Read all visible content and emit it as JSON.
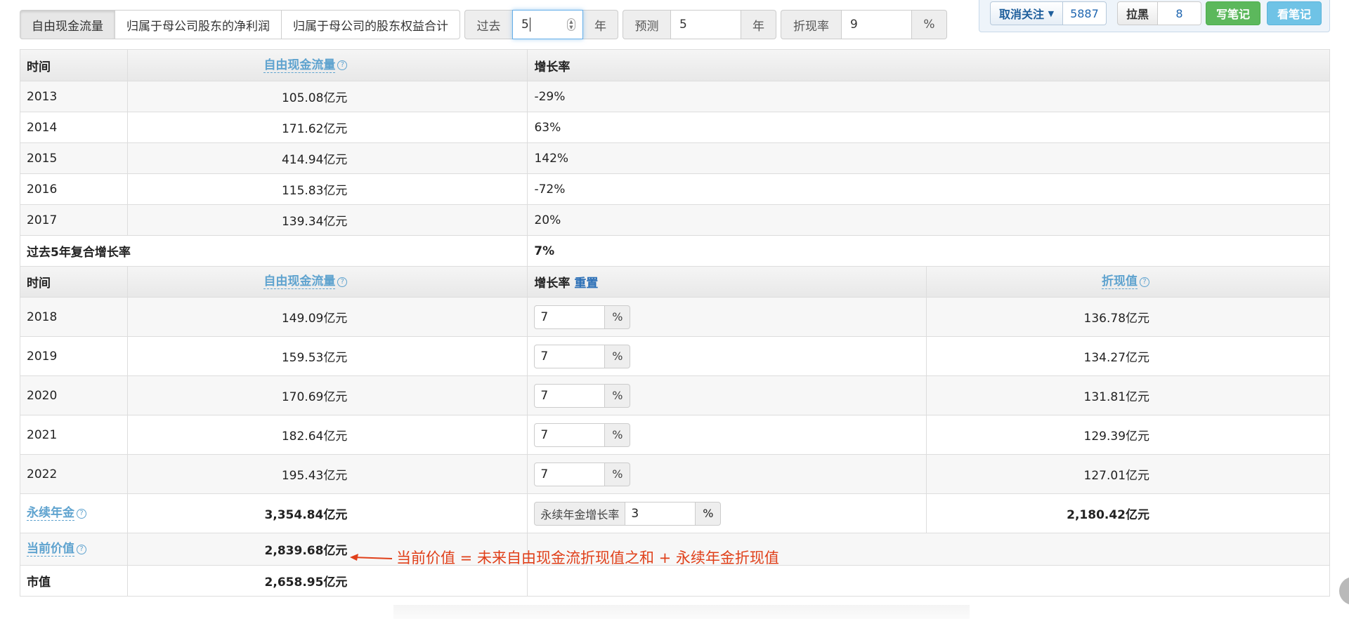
{
  "tabs": [
    "自由现金流量",
    "归属于母公司股东的净利润",
    "归属于母公司的股东权益合计"
  ],
  "params": {
    "past_label": "过去",
    "past_value": "5",
    "past_unit": "年",
    "forecast_label": "预测",
    "forecast_value": "5",
    "forecast_unit": "年",
    "discount_label": "折现率",
    "discount_value": "9",
    "discount_unit": "%"
  },
  "panel": {
    "follow_label": "取消关注",
    "follow_count": "5887",
    "block_label": "拉黑",
    "block_count": "8",
    "write_note": "写笔记",
    "view_note": "看笔记"
  },
  "history": {
    "headers": {
      "time": "时间",
      "fcf": "自由现金流量",
      "growth": "增长率"
    },
    "rows": [
      {
        "year": "2013",
        "fcf": "105.08亿元",
        "growth": "-29%"
      },
      {
        "year": "2014",
        "fcf": "171.62亿元",
        "growth": "63%"
      },
      {
        "year": "2015",
        "fcf": "414.94亿元",
        "growth": "142%"
      },
      {
        "year": "2016",
        "fcf": "115.83亿元",
        "growth": "-72%"
      },
      {
        "year": "2017",
        "fcf": "139.34亿元",
        "growth": "20%"
      }
    ],
    "cagr_label": "过去5年复合增长率",
    "cagr_value": "7%"
  },
  "forecast": {
    "headers": {
      "time": "时间",
      "fcf": "自由现金流量",
      "growth": "增长率",
      "reset": "重置",
      "pv": "折现值"
    },
    "pct": "%",
    "rows": [
      {
        "year": "2018",
        "fcf": "149.09亿元",
        "rate": "7",
        "pv": "136.78亿元"
      },
      {
        "year": "2019",
        "fcf": "159.53亿元",
        "rate": "7",
        "pv": "134.27亿元"
      },
      {
        "year": "2020",
        "fcf": "170.69亿元",
        "rate": "7",
        "pv": "131.81亿元"
      },
      {
        "year": "2021",
        "fcf": "182.64亿元",
        "rate": "7",
        "pv": "129.39亿元"
      },
      {
        "year": "2022",
        "fcf": "195.43亿元",
        "rate": "7",
        "pv": "127.01亿元"
      }
    ]
  },
  "perpetuity": {
    "label": "永续年金",
    "value": "3,354.84亿元",
    "rate_label": "永续年金增长率",
    "rate_value": "3",
    "pct": "%",
    "pv": "2,180.42亿元"
  },
  "current": {
    "label": "当前价值",
    "value": "2,839.68亿元"
  },
  "market": {
    "label": "市值",
    "value": "2,658.95亿元"
  },
  "annotation": "当前价值 = 未来自由现金流折现值之和 + 永续年金折现值",
  "colors": {
    "link": "#5fa3cf",
    "annotation": "#e0401a",
    "green": "#5cb85c",
    "cyan": "#6fc3e6"
  }
}
